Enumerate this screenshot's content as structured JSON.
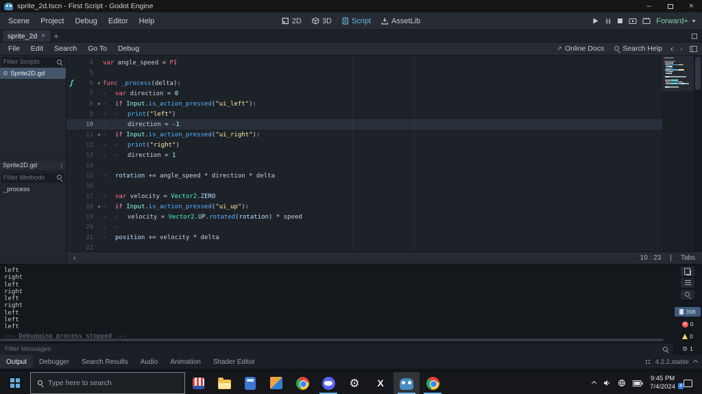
{
  "titlebar": {
    "title": "sprite_2d.tscn - First Script - Godot Engine"
  },
  "icons": {
    "minimize": "–",
    "close": "×",
    "tab_close": "×",
    "new_tab": "+",
    "nav_back": "‹",
    "nav_forward": "›",
    "panel_collapse": "‹",
    "fold_arrow": "▾",
    "tab_marker": "»",
    "methods_sort": "↕",
    "external_link": "↗"
  },
  "colors": {
    "accent": "#478cbf",
    "keyword": "#ff7085",
    "control_flow": "#ff8ccc",
    "function_call": "#57b3ff",
    "string": "#ffeda1",
    "number": "#a1ffe0",
    "base_type": "#42ffc2",
    "engine_type": "#8fffdb",
    "member": "#bce0ff",
    "renderer_label": "#7fcfa5",
    "error": "#ff5d5d",
    "warning": "#ffd166"
  },
  "menubar": {
    "menus": [
      "Scene",
      "Project",
      "Debug",
      "Editor",
      "Help"
    ],
    "workspaces": [
      {
        "label": "2D",
        "active": false
      },
      {
        "label": "3D",
        "active": false
      },
      {
        "label": "Script",
        "active": true
      },
      {
        "label": "AssetLib",
        "active": false
      }
    ],
    "renderer": "Forward+"
  },
  "scene_tabs": {
    "active_tab": "sprite_2d"
  },
  "script_toolbar": {
    "menus": [
      "File",
      "Edit",
      "Search",
      "Go To",
      "Debug"
    ],
    "online_docs": "Online Docs",
    "search_help": "Search Help"
  },
  "scripts_panel": {
    "filter_scripts_placeholder": "Filter Scripts",
    "scripts": [
      {
        "name": "Sprite2D.gd",
        "selected": true
      }
    ],
    "current_script": "Sprite2D.gd",
    "filter_methods_placeholder": "Filter Methods",
    "methods": [
      "_process"
    ]
  },
  "code_editor": {
    "status": {
      "cursor": "10 : 23",
      "separator": "|",
      "indent": "Tabs"
    },
    "lines": [
      {
        "n": 4,
        "segs": [
          {
            "c": "k",
            "t": "var"
          },
          {
            "c": "t",
            "t": " angle_speed = "
          },
          {
            "c": "k",
            "t": "PI"
          }
        ]
      },
      {
        "n": 5,
        "segs": []
      },
      {
        "n": 6,
        "fold": true,
        "conn": true,
        "segs": [
          {
            "c": "k",
            "t": "func"
          },
          {
            "c": "t",
            "t": " "
          },
          {
            "c": "fn",
            "t": "_process"
          },
          {
            "c": "t",
            "t": "(delta):"
          }
        ]
      },
      {
        "n": 7,
        "segs": [
          {
            "c": "tab",
            "t": "»"
          },
          {
            "c": "k",
            "t": "var"
          },
          {
            "c": "t",
            "t": " direction = "
          },
          {
            "c": "num",
            "t": "0"
          }
        ]
      },
      {
        "n": 8,
        "fold": true,
        "segs": [
          {
            "c": "tab",
            "t": "»"
          },
          {
            "c": "cf",
            "t": "if"
          },
          {
            "c": "t",
            "t": " "
          },
          {
            "c": "et",
            "t": "Input"
          },
          {
            "c": "t",
            "t": "."
          },
          {
            "c": "fn",
            "t": "is_action_pressed"
          },
          {
            "c": "t",
            "t": "("
          },
          {
            "c": "str",
            "t": "\"ui_left\""
          },
          {
            "c": "t",
            "t": "):"
          }
        ]
      },
      {
        "n": 9,
        "segs": [
          {
            "c": "tab",
            "t": "»"
          },
          {
            "c": "tab",
            "t": "»"
          },
          {
            "c": "fn",
            "t": "print"
          },
          {
            "c": "t",
            "t": "("
          },
          {
            "c": "str",
            "t": "\"left\""
          },
          {
            "c": "t",
            "t": ")"
          }
        ]
      },
      {
        "n": 10,
        "current": true,
        "segs": [
          {
            "c": "tab",
            "t": "»"
          },
          {
            "c": "tab",
            "t": "»"
          },
          {
            "c": "t",
            "t": "direction = -"
          },
          {
            "c": "num",
            "t": "1"
          }
        ]
      },
      {
        "n": 11,
        "fold": true,
        "segs": [
          {
            "c": "tab",
            "t": "»"
          },
          {
            "c": "cf",
            "t": "if"
          },
          {
            "c": "t",
            "t": " "
          },
          {
            "c": "et",
            "t": "Input"
          },
          {
            "c": "t",
            "t": "."
          },
          {
            "c": "fn",
            "t": "is_action_pressed"
          },
          {
            "c": "t",
            "t": "("
          },
          {
            "c": "str",
            "t": "\"ui_right\""
          },
          {
            "c": "t",
            "t": "):"
          }
        ]
      },
      {
        "n": 12,
        "segs": [
          {
            "c": "tab",
            "t": "»"
          },
          {
            "c": "tab",
            "t": "»"
          },
          {
            "c": "fn",
            "t": "print"
          },
          {
            "c": "t",
            "t": "("
          },
          {
            "c": "str",
            "t": "\"right\""
          },
          {
            "c": "t",
            "t": ")"
          }
        ]
      },
      {
        "n": 13,
        "segs": [
          {
            "c": "tab",
            "t": "»"
          },
          {
            "c": "tab",
            "t": "»"
          },
          {
            "c": "t",
            "t": "direction = "
          },
          {
            "c": "num",
            "t": "1"
          }
        ]
      },
      {
        "n": 14,
        "segs": []
      },
      {
        "n": 15,
        "segs": [
          {
            "c": "tab",
            "t": "»"
          },
          {
            "c": "mem",
            "t": "rotation"
          },
          {
            "c": "t",
            "t": " += angle_speed * direction * delta"
          }
        ]
      },
      {
        "n": 16,
        "segs": []
      },
      {
        "n": 17,
        "segs": [
          {
            "c": "tab",
            "t": "»"
          },
          {
            "c": "k",
            "t": "var"
          },
          {
            "c": "t",
            "t": " velocity = "
          },
          {
            "c": "ty",
            "t": "Vector2"
          },
          {
            "c": "t",
            "t": "."
          },
          {
            "c": "mem",
            "t": "ZERO"
          }
        ]
      },
      {
        "n": 18,
        "fold": true,
        "segs": [
          {
            "c": "tab",
            "t": "»"
          },
          {
            "c": "cf",
            "t": "if"
          },
          {
            "c": "t",
            "t": " "
          },
          {
            "c": "et",
            "t": "Input"
          },
          {
            "c": "t",
            "t": "."
          },
          {
            "c": "fn",
            "t": "is_action_pressed"
          },
          {
            "c": "t",
            "t": "("
          },
          {
            "c": "str",
            "t": "\"ui_up\""
          },
          {
            "c": "t",
            "t": "):"
          }
        ]
      },
      {
        "n": 19,
        "segs": [
          {
            "c": "tab",
            "t": "»"
          },
          {
            "c": "tab",
            "t": "»"
          },
          {
            "c": "t",
            "t": "velocity = "
          },
          {
            "c": "ty",
            "t": "Vector2"
          },
          {
            "c": "t",
            "t": "."
          },
          {
            "c": "mem",
            "t": "UP"
          },
          {
            "c": "t",
            "t": "."
          },
          {
            "c": "fn",
            "t": "rotated"
          },
          {
            "c": "t",
            "t": "("
          },
          {
            "c": "mem",
            "t": "rotation"
          },
          {
            "c": "t",
            "t": ") * speed"
          }
        ]
      },
      {
        "n": 20,
        "segs": [
          {
            "c": "tab",
            "t": "»"
          },
          {
            "c": "tab",
            "t": "»"
          }
        ]
      },
      {
        "n": 21,
        "segs": [
          {
            "c": "tab",
            "t": "»"
          },
          {
            "c": "mem",
            "t": "position"
          },
          {
            "c": "t",
            "t": " += velocity * delta"
          }
        ]
      },
      {
        "n": 22,
        "segs": []
      }
    ]
  },
  "output_panel": {
    "lines": [
      "left",
      "right",
      "left",
      "right",
      "left",
      "right",
      "left",
      "left",
      "left"
    ],
    "notice": "--- Debugging process stopped ---",
    "filter_placeholder": "Filter Messages",
    "filters": [
      {
        "name": "messages",
        "count": "398",
        "active": true
      },
      {
        "name": "errors",
        "count": "0",
        "active": false
      },
      {
        "name": "warnings",
        "count": "0",
        "active": false
      },
      {
        "name": "editor",
        "count": "1",
        "active": false
      }
    ]
  },
  "bottom_bar": {
    "tabs": [
      {
        "label": "Output",
        "active": true
      },
      {
        "label": "Debugger",
        "active": false
      },
      {
        "label": "Search Results",
        "active": false
      },
      {
        "label": "Audio",
        "active": false
      },
      {
        "label": "Animation",
        "active": false
      },
      {
        "label": "Shader Editor",
        "active": false
      }
    ],
    "version": "4.2.2.stable"
  },
  "taskbar": {
    "search_placeholder": "Type here to search",
    "apps": [
      {
        "name": "striped-hat",
        "open": false,
        "active": false
      },
      {
        "name": "file-explorer",
        "open": false,
        "active": false
      },
      {
        "name": "calculator",
        "open": false,
        "active": false
      },
      {
        "name": "photos",
        "open": false,
        "active": false
      },
      {
        "name": "chrome",
        "open": false,
        "active": false
      },
      {
        "name": "discord",
        "open": true,
        "active": false
      },
      {
        "name": "settings",
        "open": false,
        "active": false
      },
      {
        "name": "x-app",
        "open": false,
        "active": false
      },
      {
        "name": "godot",
        "open": true,
        "active": true
      },
      {
        "name": "chrome-2",
        "open": true,
        "active": false
      }
    ],
    "clock": {
      "time": "9:45 PM",
      "date": "7/4/2024"
    },
    "notification_count": "4"
  }
}
